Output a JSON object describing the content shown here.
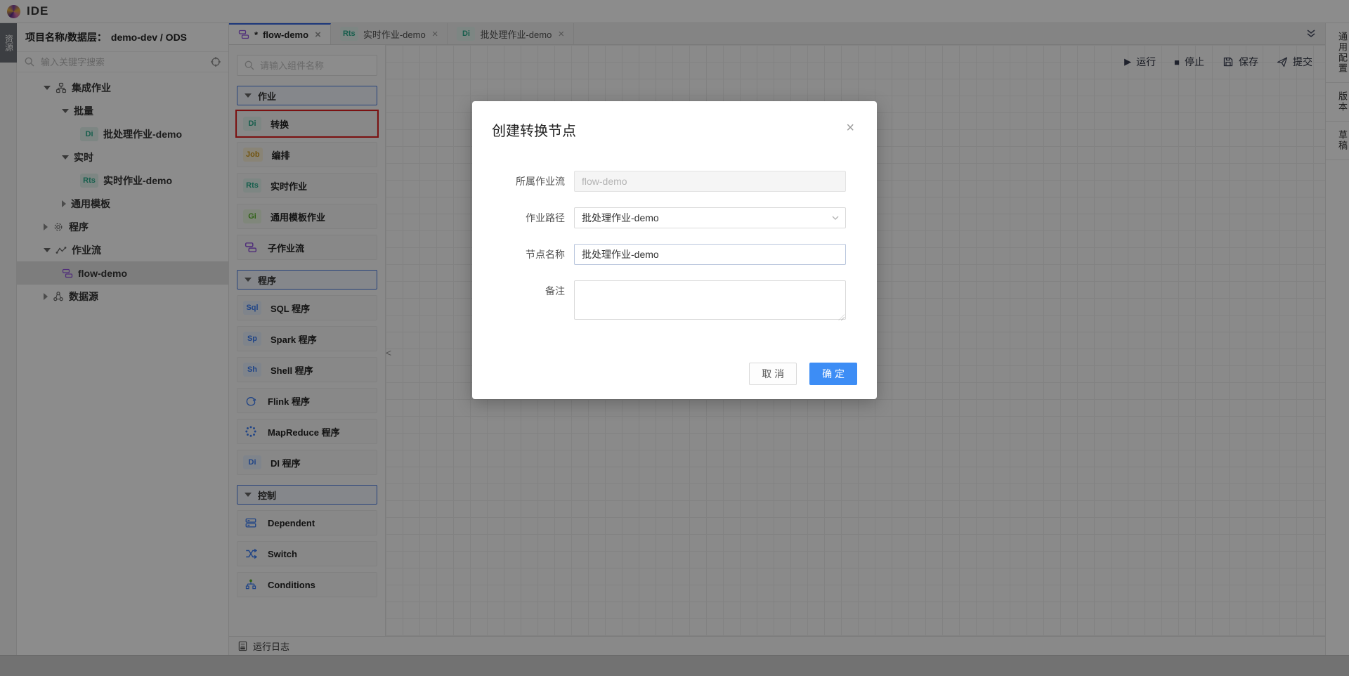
{
  "app": {
    "title": "IDE"
  },
  "glyphs": {
    "close": "×",
    "star": "*",
    "run": "▶",
    "stop": "■",
    "collapse_left": "<"
  },
  "activity_bar": {
    "resources_label": "资源"
  },
  "explorer": {
    "header_label": "项目名称/数据层：",
    "header_value": "demo-dev / ODS",
    "search_placeholder": "输入关键字搜索",
    "tree": [
      {
        "label": "集成作业"
      },
      {
        "label": "批量"
      },
      {
        "label": "批处理作业-demo",
        "badge": "Di"
      },
      {
        "label": "实时"
      },
      {
        "label": "实时作业-demo",
        "badge": "Rts"
      },
      {
        "label": "通用模板"
      },
      {
        "label": "程序"
      },
      {
        "label": "作业流"
      },
      {
        "label": "flow-demo"
      },
      {
        "label": "数据源"
      }
    ]
  },
  "tabs": [
    {
      "label": "flow-demo",
      "modified": true
    },
    {
      "label": "实时作业-demo",
      "badge": "Rts"
    },
    {
      "label": "批处理作业-demo",
      "badge": "Di"
    }
  ],
  "component_panel": {
    "search_placeholder": "请输入组件名称",
    "sections": [
      {
        "title": "作业",
        "items": [
          {
            "label": "转换",
            "badge": "Di"
          },
          {
            "label": "编排",
            "badge": "Job"
          },
          {
            "label": "实时作业",
            "badge": "Rts"
          },
          {
            "label": "通用模板作业",
            "badge": "Gi"
          },
          {
            "label": "子作业流"
          }
        ]
      },
      {
        "title": "程序",
        "items": [
          {
            "label": "SQL 程序",
            "badge": "Sql"
          },
          {
            "label": "Spark 程序",
            "badge": "Sp"
          },
          {
            "label": "Shell 程序",
            "badge": "Sh"
          },
          {
            "label": "Flink 程序"
          },
          {
            "label": "MapReduce 程序"
          },
          {
            "label": "DI 程序",
            "badge": "Di"
          }
        ]
      },
      {
        "title": "控制",
        "items": [
          {
            "label": "Dependent"
          },
          {
            "label": "Switch"
          },
          {
            "label": "Conditions"
          }
        ]
      }
    ]
  },
  "canvas_toolbar": {
    "run": "运行",
    "stop": "停止",
    "save": "保存",
    "submit": "提交"
  },
  "right_bar": {
    "items": [
      "通用配置",
      "版本",
      "草稿"
    ]
  },
  "bottom_bar": {
    "log_label": "运行日志"
  },
  "modal": {
    "title": "创建转换节点",
    "fields": {
      "flow": {
        "label": "所属作业流",
        "value": "flow-demo"
      },
      "path": {
        "label": "作业路径",
        "value": "批处理作业-demo"
      },
      "name": {
        "label": "节点名称",
        "value": "批处理作业-demo"
      },
      "remark": {
        "label": "备注",
        "value": ""
      }
    },
    "cancel_label": "取 消",
    "ok_label": "确 定"
  },
  "colors": {
    "primary_blue": "#3d8df5",
    "active_tab_blue": "#3464e0",
    "section_border_blue": "#4a7ae0",
    "highlight_red": "#e02020",
    "badge_teal": "#2bab8c",
    "badge_yellow": "#cf9a1d",
    "badge_green": "#58b32a",
    "badge_blue": "#3d7ef5",
    "subflow_purple": "#9254de",
    "mask": "rgba(0,0,0,0.45)"
  }
}
